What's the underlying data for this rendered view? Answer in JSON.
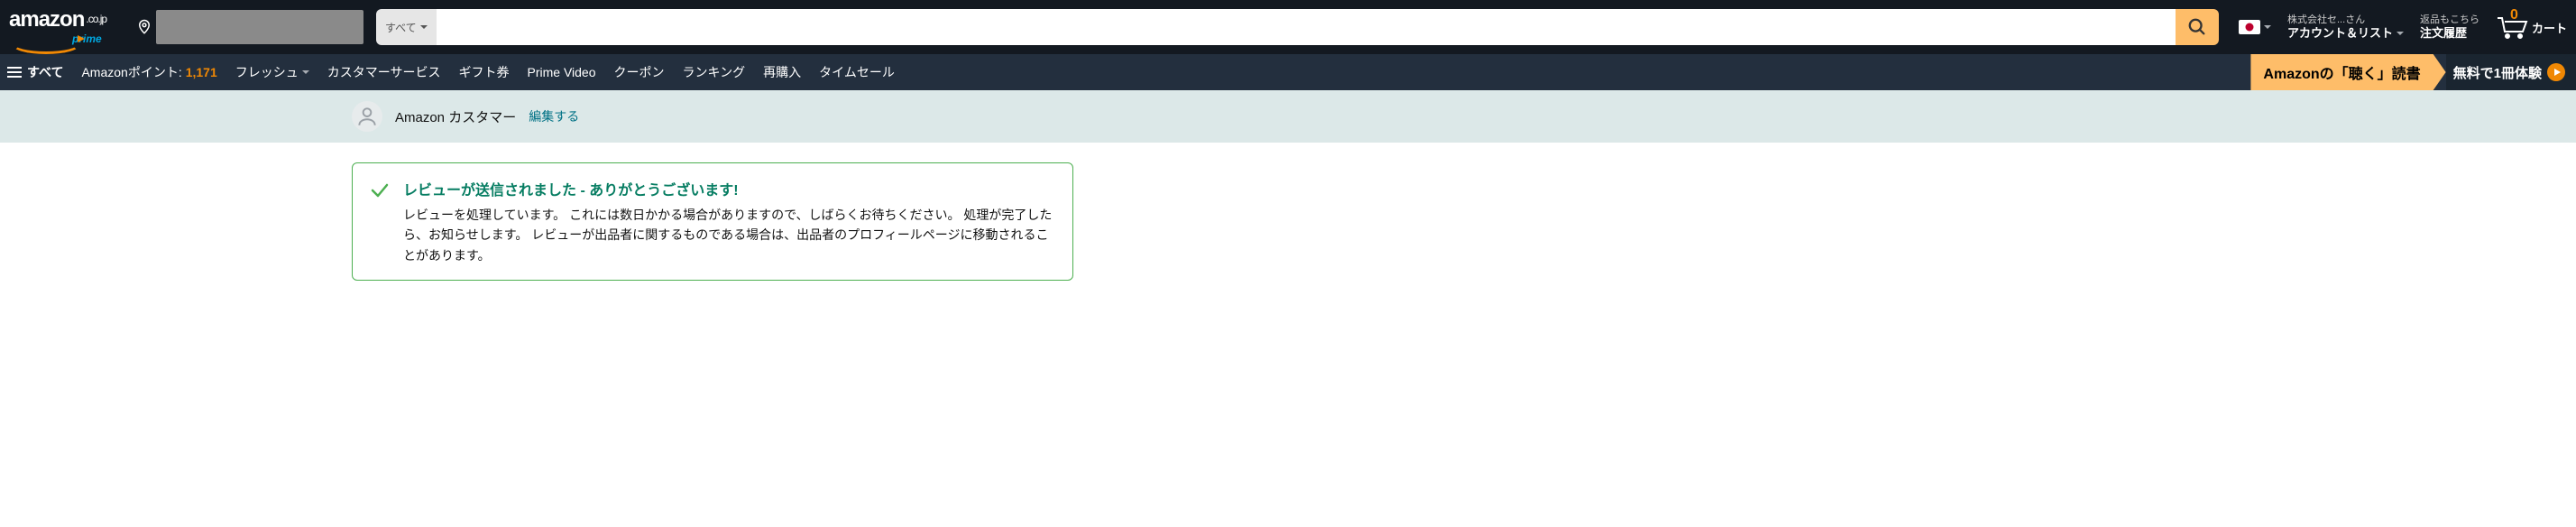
{
  "logo": {
    "word": "amazon",
    "suffix": ".co.jp",
    "prime": "prime"
  },
  "search": {
    "scope": "すべて",
    "placeholder": ""
  },
  "account": {
    "greeting": "株式会社セ...さん",
    "label": "アカウント＆リスト"
  },
  "orders": {
    "small": "返品もこちら",
    "label": "注文履歴"
  },
  "cart": {
    "count": "0",
    "label": "カート"
  },
  "allmenu": "すべて",
  "points": {
    "label": "Amazonポイント: ",
    "value": "1,171"
  },
  "nav_items": {
    "fresh": "フレッシュ",
    "customer_service": "カスタマーサービス",
    "gift": "ギフト券",
    "prime_video": "Prime Video",
    "coupon": "クーポン",
    "ranking": "ランキング",
    "buy_again": "再購入",
    "time_sale": "タイムセール"
  },
  "promo": {
    "left": "Amazonの「聴く」読書",
    "right": "無料で1冊体験"
  },
  "strip": {
    "name": "Amazon カスタマー",
    "edit": "編集する"
  },
  "alert": {
    "title": "レビューが送信されました - ありがとうございます!",
    "body": "レビューを処理しています。 これには数日かかる場合がありますので、しばらくお待ちください。 処理が完了したら、お知らせします。 レビューが出品者に関するものである場合は、出品者のプロフィールページに移動されることがあります。"
  }
}
